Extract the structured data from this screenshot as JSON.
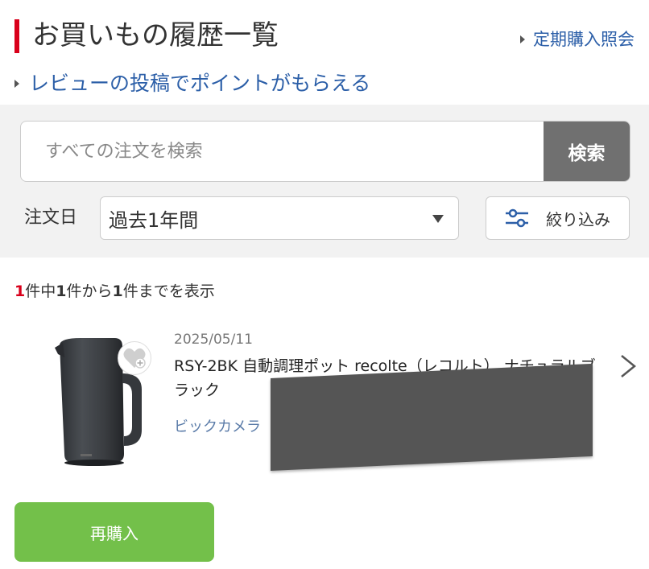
{
  "header": {
    "title": "お買いもの履歴一覧",
    "teiki_link": "定期購入照会",
    "review_link": "レビューの投稿でポイントがもらえる"
  },
  "search": {
    "placeholder": "すべての注文を検索",
    "button_label": "検索"
  },
  "filter": {
    "date_label": "注文日",
    "date_selected": "過去1年間",
    "filter_button_label": "絞り込み"
  },
  "results": {
    "count_total": "1",
    "count_text_1": "件中",
    "count_from": "1",
    "count_text_2": "件から",
    "count_to": "1",
    "count_text_3": "件までを表示"
  },
  "orders": [
    {
      "date": "2025/05/11",
      "name": "RSY-2BK 自動調理ポット recolte（レコルト） ナチュラルブラック",
      "shop": "ビックカメラ",
      "rebuy_label": "再購入"
    }
  ],
  "colors": {
    "accent_red": "#d9001b",
    "link_blue": "#2c5fa8",
    "rebuy_green": "#73c04a",
    "search_button_gray": "#707070"
  }
}
